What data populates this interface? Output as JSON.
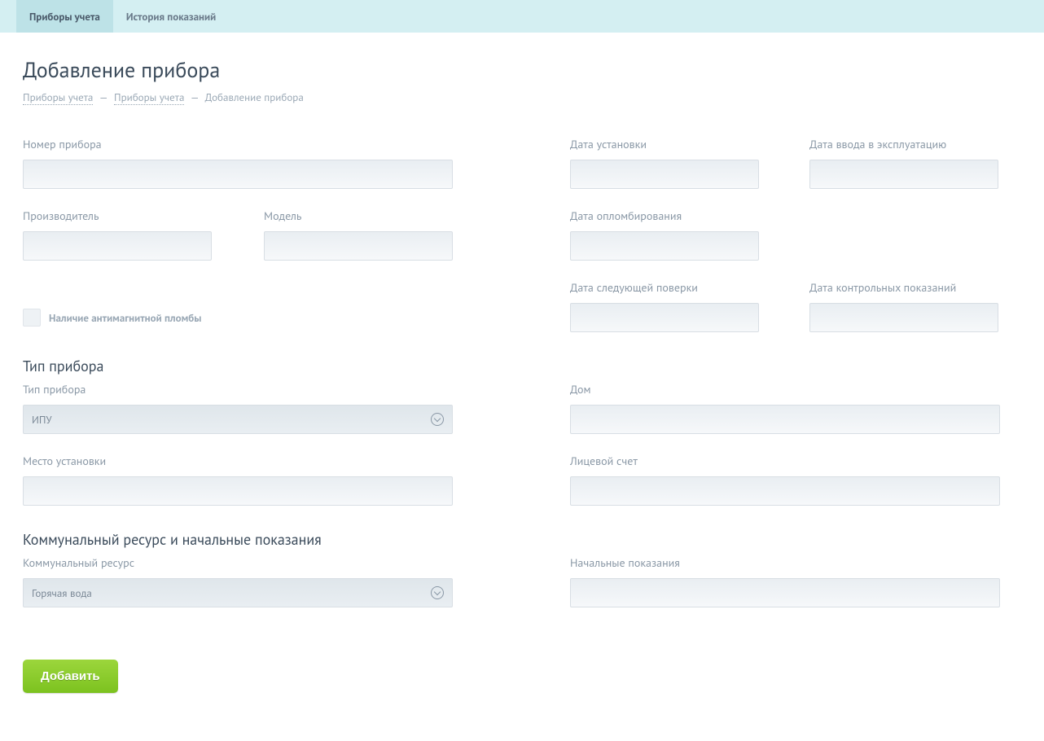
{
  "tabs": {
    "meters": "Приборы учета",
    "history": "История показаний"
  },
  "page_title": "Добавление прибора",
  "breadcrumb": {
    "a": "Приборы учета",
    "b": "Приборы учета",
    "c": "Добавление прибора",
    "sep": "—"
  },
  "labels": {
    "device_number": "Номер прибора",
    "install_date": "Дата установки",
    "commission_date": "Дата ввода в эксплуатацию",
    "manufacturer": "Производитель",
    "model": "Модель",
    "seal_date": "Дата опломбирования",
    "antimagnetic": "Наличие антимагнитной пломбы",
    "next_check_date": "Дата следующей поверки",
    "control_read_date": "Дата контрольных показаний"
  },
  "sections": {
    "device_type": "Тип прибора",
    "resource": "Коммунальный ресурс и начальные показания"
  },
  "type_labels": {
    "device_type": "Тип прибора",
    "house": "Дом",
    "install_place": "Место установки",
    "account": "Лицевой счет"
  },
  "resource_labels": {
    "resource": "Коммунальный ресурс",
    "initial": "Начальные показания"
  },
  "selects": {
    "device_type_value": "ИПУ",
    "resource_value": "Горячая вода"
  },
  "buttons": {
    "add": "Добавить"
  }
}
